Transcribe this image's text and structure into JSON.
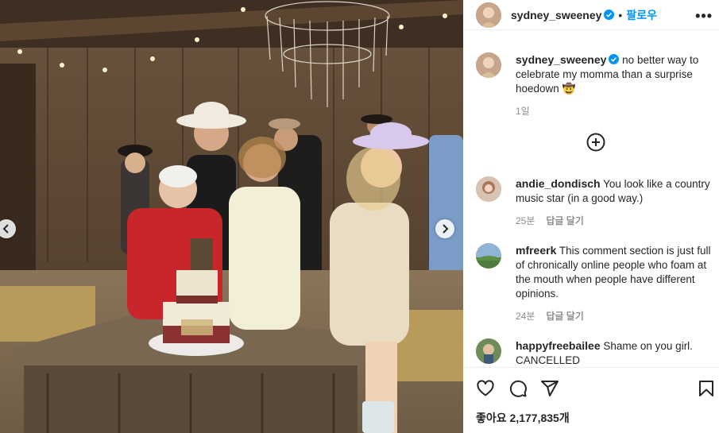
{
  "header": {
    "username": "sydney_sweeney",
    "separator": "•",
    "follow_label": "팔로우",
    "more_label": "•••"
  },
  "caption": {
    "username": "sydney_sweeney",
    "text": "no better way to celebrate my momma than a surprise hoedown 🤠",
    "time": "1일"
  },
  "comments": [
    {
      "username": "andie_dondisch",
      "text": "You look like a country music star (in a good way.)",
      "time": "25분",
      "reply_label": "답글 달기"
    },
    {
      "username": "mfreerk",
      "text": "This comment section is just full of chronically online people who foam at the mouth when people have different opinions.",
      "time": "24분",
      "reply_label": "답글 달기"
    },
    {
      "username": "happyfreebailee",
      "text": "Shame on you girl. CANCELLED",
      "time": "",
      "reply_label": ""
    }
  ],
  "actions": {
    "likes_label": "좋아요",
    "likes_count": "2,177,835개"
  },
  "colors": {
    "accent": "#0095f6",
    "text": "#262626",
    "muted": "#8e8e8e",
    "verified": "#0095f6"
  }
}
